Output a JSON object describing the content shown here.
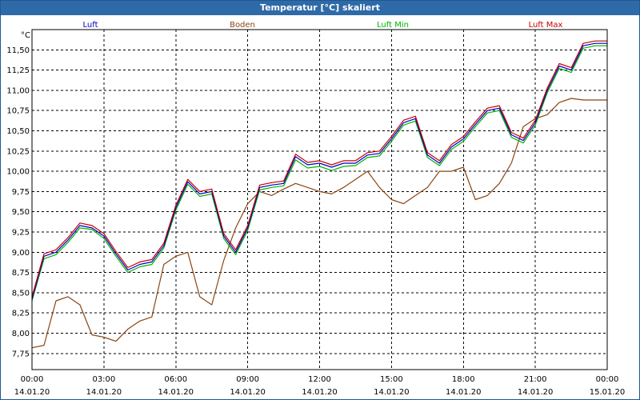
{
  "title": "Temperatur [°C] skaliert",
  "chart_data": {
    "type": "line",
    "title": "Temperatur [°C] skaliert",
    "ylabel": "°C",
    "xlabel": "",
    "ylim": [
      7.55,
      11.75
    ],
    "grid": true,
    "legend": "top",
    "yticks": [
      "7,75",
      "8,00",
      "8,25",
      "8,50",
      "8,75",
      "9,00",
      "9,25",
      "9,50",
      "9,75",
      "10,00",
      "10,25",
      "10,50",
      "10,75",
      "11,00",
      "11,25",
      "11,50"
    ],
    "ytick_values": [
      7.75,
      8.0,
      8.25,
      8.5,
      8.75,
      9.0,
      9.25,
      9.5,
      9.75,
      10.0,
      10.25,
      10.5,
      10.75,
      11.0,
      11.25,
      11.5
    ],
    "xticks_time": [
      "00:00",
      "03:00",
      "06:00",
      "09:00",
      "12:00",
      "15:00",
      "18:00",
      "21:00",
      "00:00"
    ],
    "xticks_date": [
      "14.01.20",
      "14.01.20",
      "14.01.20",
      "14.01.20",
      "14.01.20",
      "14.01.20",
      "14.01.20",
      "14.01.20",
      "15.01.20"
    ],
    "x_hours": [
      0,
      0.5,
      1,
      1.5,
      2,
      2.5,
      3,
      3.5,
      4,
      4.5,
      5,
      5.5,
      6,
      6.5,
      7,
      7.5,
      8,
      8.5,
      9,
      9.5,
      10,
      10.5,
      11,
      11.5,
      12,
      12.5,
      13,
      13.5,
      14,
      14.5,
      15,
      15.5,
      16,
      16.5,
      17,
      17.5,
      18,
      18.5,
      19,
      19.5,
      20,
      20.5,
      21,
      21.5,
      22,
      22.5,
      23,
      23.5,
      24
    ],
    "series": [
      {
        "name": "Luft",
        "color": "#0000c8",
        "values": [
          8.42,
          8.95,
          9.0,
          9.15,
          9.33,
          9.3,
          9.2,
          8.98,
          8.78,
          8.85,
          8.88,
          9.08,
          9.55,
          9.87,
          9.72,
          9.75,
          9.2,
          9.0,
          9.3,
          9.8,
          9.83,
          9.85,
          10.18,
          10.08,
          10.1,
          10.05,
          10.1,
          10.1,
          10.2,
          10.22,
          10.4,
          10.6,
          10.65,
          10.2,
          10.1,
          10.3,
          10.4,
          10.58,
          10.75,
          10.78,
          10.45,
          10.38,
          10.6,
          11.0,
          11.3,
          11.25,
          11.55,
          11.58,
          11.58
        ]
      },
      {
        "name": "Boden",
        "color": "#8b4513",
        "values": [
          7.82,
          7.85,
          8.4,
          8.45,
          8.35,
          7.98,
          7.95,
          7.9,
          8.05,
          8.15,
          8.2,
          8.85,
          8.95,
          9.0,
          8.45,
          8.35,
          8.9,
          9.3,
          9.6,
          9.75,
          9.7,
          9.78,
          9.85,
          9.8,
          9.75,
          9.72,
          9.8,
          9.9,
          10.0,
          9.8,
          9.65,
          9.6,
          9.7,
          9.8,
          10.0,
          10.0,
          10.05,
          9.65,
          9.7,
          9.85,
          10.1,
          10.55,
          10.65,
          10.7,
          10.85,
          10.9,
          10.88,
          10.88,
          10.88
        ]
      },
      {
        "name": "Luft Min",
        "color": "#00b400",
        "values": [
          8.4,
          8.92,
          8.97,
          9.12,
          9.3,
          9.28,
          9.17,
          8.95,
          8.75,
          8.82,
          8.85,
          9.05,
          9.52,
          9.84,
          9.69,
          9.72,
          9.17,
          8.97,
          9.27,
          9.77,
          9.8,
          9.82,
          10.14,
          10.04,
          10.06,
          10.01,
          10.06,
          10.07,
          10.17,
          10.19,
          10.37,
          10.57,
          10.62,
          10.17,
          10.07,
          10.27,
          10.37,
          10.55,
          10.72,
          10.75,
          10.42,
          10.35,
          10.57,
          10.97,
          11.27,
          11.22,
          11.52,
          11.55,
          11.55
        ]
      },
      {
        "name": "Luft Max",
        "color": "#c80000",
        "values": [
          8.45,
          8.98,
          9.03,
          9.18,
          9.36,
          9.33,
          9.23,
          9.01,
          8.81,
          8.88,
          8.91,
          9.11,
          9.58,
          9.9,
          9.75,
          9.78,
          9.23,
          9.03,
          9.33,
          9.83,
          9.86,
          9.88,
          10.21,
          10.11,
          10.13,
          10.08,
          10.13,
          10.13,
          10.23,
          10.25,
          10.43,
          10.63,
          10.68,
          10.23,
          10.13,
          10.33,
          10.43,
          10.61,
          10.78,
          10.81,
          10.48,
          10.41,
          10.63,
          11.03,
          11.33,
          11.28,
          11.58,
          11.61,
          11.61
        ]
      }
    ]
  }
}
